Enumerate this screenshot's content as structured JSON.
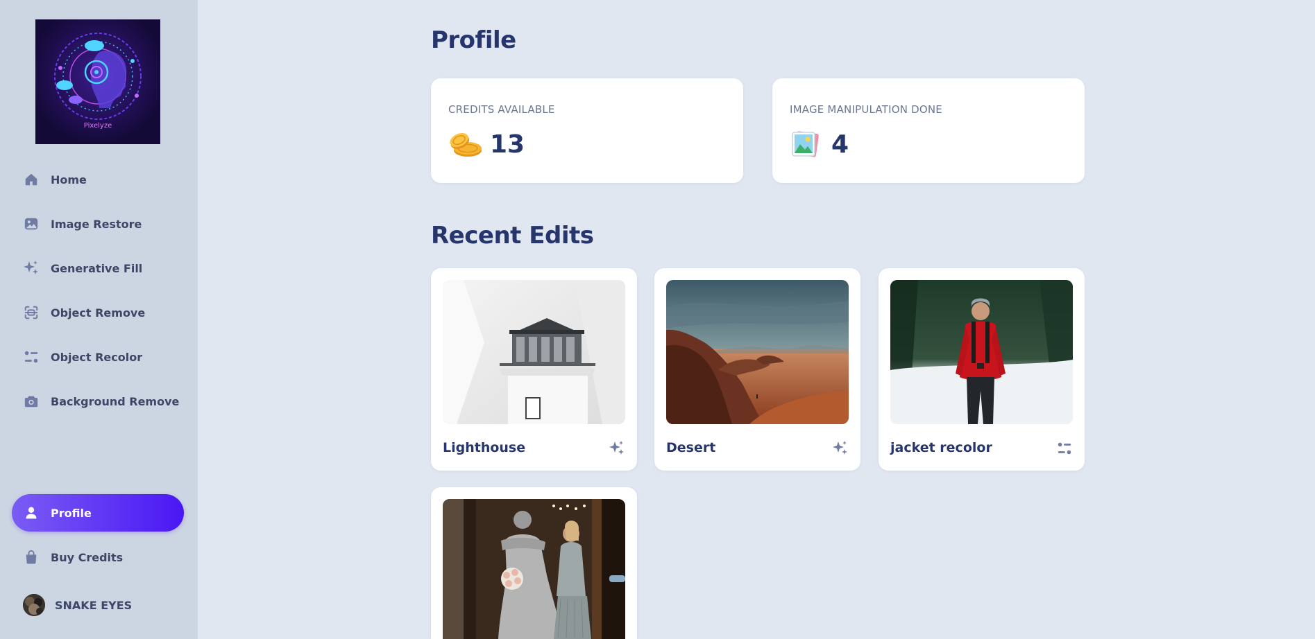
{
  "sidebar": {
    "logo": {
      "text": "Pixelyze"
    },
    "nav_items": [
      {
        "label": "Home",
        "icon": "home-icon"
      },
      {
        "label": "Image Restore",
        "icon": "image-icon"
      },
      {
        "label": "Generative Fill",
        "icon": "sparkles-icon"
      },
      {
        "label": "Object Remove",
        "icon": "scan-icon"
      },
      {
        "label": "Object Recolor",
        "icon": "sliders-icon"
      },
      {
        "label": "Background Remove",
        "icon": "camera-icon"
      }
    ],
    "bottom_items": [
      {
        "label": "Profile",
        "icon": "user-icon",
        "active": true
      },
      {
        "label": "Buy Credits",
        "icon": "shopping-bag-icon"
      }
    ],
    "user": {
      "name": "SNAKE EYES",
      "avatar": "avatar-image"
    }
  },
  "main": {
    "profile_title": "Profile",
    "stats": [
      {
        "label": "CREDITS AVAILABLE",
        "value": "13",
        "icon": "coins-icon"
      },
      {
        "label": "IMAGE MANIPULATION DONE",
        "value": "4",
        "icon": "photo-icon"
      }
    ],
    "recent_title": "Recent Edits",
    "recent_edits": [
      {
        "title": "Lighthouse",
        "type_icon": "sparkles-icon"
      },
      {
        "title": "Desert",
        "type_icon": "sparkles-icon"
      },
      {
        "title": "jacket recolor",
        "type_icon": "sliders-icon"
      },
      {
        "title": "",
        "type_icon": ""
      }
    ]
  },
  "colors": {
    "accent": "#4a17f5",
    "accent_light": "#7a5cf4",
    "sidebar_bg": "#ccd5e2",
    "page_bg": "#e1e7f1",
    "heading": "#26356c",
    "icon_muted": "#6f7ba3"
  }
}
